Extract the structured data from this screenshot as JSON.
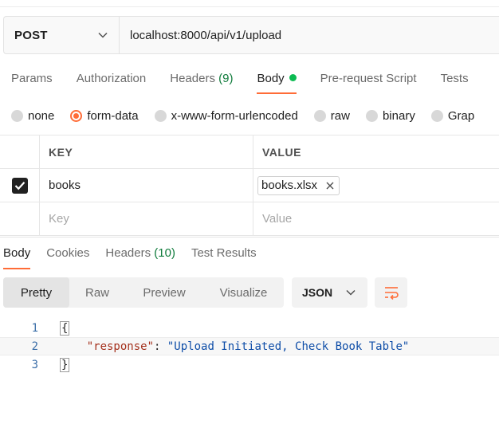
{
  "request": {
    "method": "POST",
    "url": "localhost:8000/api/v1/upload"
  },
  "request_tabs": [
    {
      "label": "Params"
    },
    {
      "label": "Authorization"
    },
    {
      "label": "Headers",
      "count": "(9)"
    },
    {
      "label": "Body",
      "active": true
    },
    {
      "label": "Pre-request Script"
    },
    {
      "label": "Tests"
    }
  ],
  "body_types": [
    {
      "label": "none"
    },
    {
      "label": "form-data",
      "selected": true
    },
    {
      "label": "x-www-form-urlencoded"
    },
    {
      "label": "raw"
    },
    {
      "label": "binary"
    },
    {
      "label": "Grap"
    }
  ],
  "form_table": {
    "headers": {
      "key": "KEY",
      "value": "VALUE"
    },
    "rows": [
      {
        "checked": true,
        "key": "books",
        "file": "books.xlsx"
      }
    ],
    "placeholder": {
      "key": "Key",
      "value": "Value"
    }
  },
  "response_tabs": [
    {
      "label": "Body",
      "active": true
    },
    {
      "label": "Cookies"
    },
    {
      "label": "Headers",
      "count": "(10)"
    },
    {
      "label": "Test Results"
    }
  ],
  "format_modes": [
    {
      "label": "Pretty",
      "active": true
    },
    {
      "label": "Raw"
    },
    {
      "label": "Preview"
    },
    {
      "label": "Visualize"
    }
  ],
  "language": "JSON",
  "code": {
    "lines": [
      "1",
      "2",
      "3"
    ],
    "open_brace": "{",
    "close_brace": "}",
    "key": "\"response\"",
    "colon": ": ",
    "value": "\"Upload Initiated, Check Book Table\""
  },
  "colors": {
    "accent": "#ff6c37",
    "success": "#0cbb52",
    "count": "#0f7b3b"
  },
  "icons": {
    "method_dropdown": "chevron-down-icon",
    "language_dropdown": "chevron-down-icon",
    "remove_file": "close-icon",
    "wrap": "wrap-lines-icon",
    "row_check": "checkmark-icon"
  }
}
